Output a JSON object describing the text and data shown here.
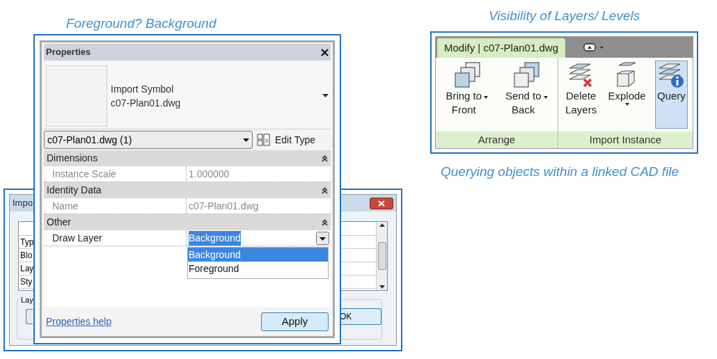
{
  "properties_caption": "Foreground? Background",
  "ribbon_caption": "Visibility of Layers/ Levels",
  "query_caption": "Querying objects within a linked CAD file",
  "import_dialog": {
    "title": "Impo",
    "rows": [
      "Typ",
      "Blo",
      "Lay",
      "Sty"
    ],
    "group_label": "Lay",
    "ok_button": "OK"
  },
  "properties": {
    "title": "Properties",
    "type_lines": [
      "Import Symbol",
      "c07-Plan01.dwg"
    ],
    "instance_selector": "c07-Plan01.dwg (1)",
    "edit_type": "Edit Type",
    "sections": [
      {
        "name": "Dimensions",
        "expanded": true,
        "rows": [
          {
            "label": "Instance Scale",
            "value": "1.000000",
            "disabled": true,
            "open": false
          }
        ]
      },
      {
        "name": "Identity Data",
        "expanded": true,
        "rows": [
          {
            "label": "Name",
            "value": "c07-Plan01.dwg",
            "disabled": true,
            "open": false
          }
        ]
      },
      {
        "name": "Other",
        "expanded": true,
        "rows": [
          {
            "label": "Draw Layer",
            "value": "Background",
            "disabled": false,
            "open": true
          }
        ]
      }
    ],
    "dropdown_options": [
      {
        "label": "Background",
        "selected": true
      },
      {
        "label": "Foreground",
        "selected": false
      }
    ],
    "help_link": "Properties help",
    "apply_button": "Apply"
  },
  "ribbon": {
    "tabs": [
      {
        "label": "Modify | c07-Plan01.dwg",
        "selected": true
      }
    ],
    "panels": [
      {
        "label": "Arrange",
        "buttons": [
          {
            "kind": "bring-front",
            "lines": [
              "Bring to",
              "Front"
            ],
            "has_menu": true,
            "selected": false
          },
          {
            "kind": "send-back",
            "lines": [
              "Send to",
              "Back"
            ],
            "has_menu": true,
            "selected": false
          }
        ]
      },
      {
        "label": "Import Instance",
        "buttons": [
          {
            "kind": "delete-layers",
            "lines": [
              "Delete",
              "Layers"
            ],
            "has_menu": false,
            "selected": false
          },
          {
            "kind": "explode",
            "lines": [
              "Explode"
            ],
            "has_menu": true,
            "selected": false
          },
          {
            "kind": "query",
            "lines": [
              "Query"
            ],
            "has_menu": false,
            "selected": true
          }
        ]
      }
    ]
  }
}
